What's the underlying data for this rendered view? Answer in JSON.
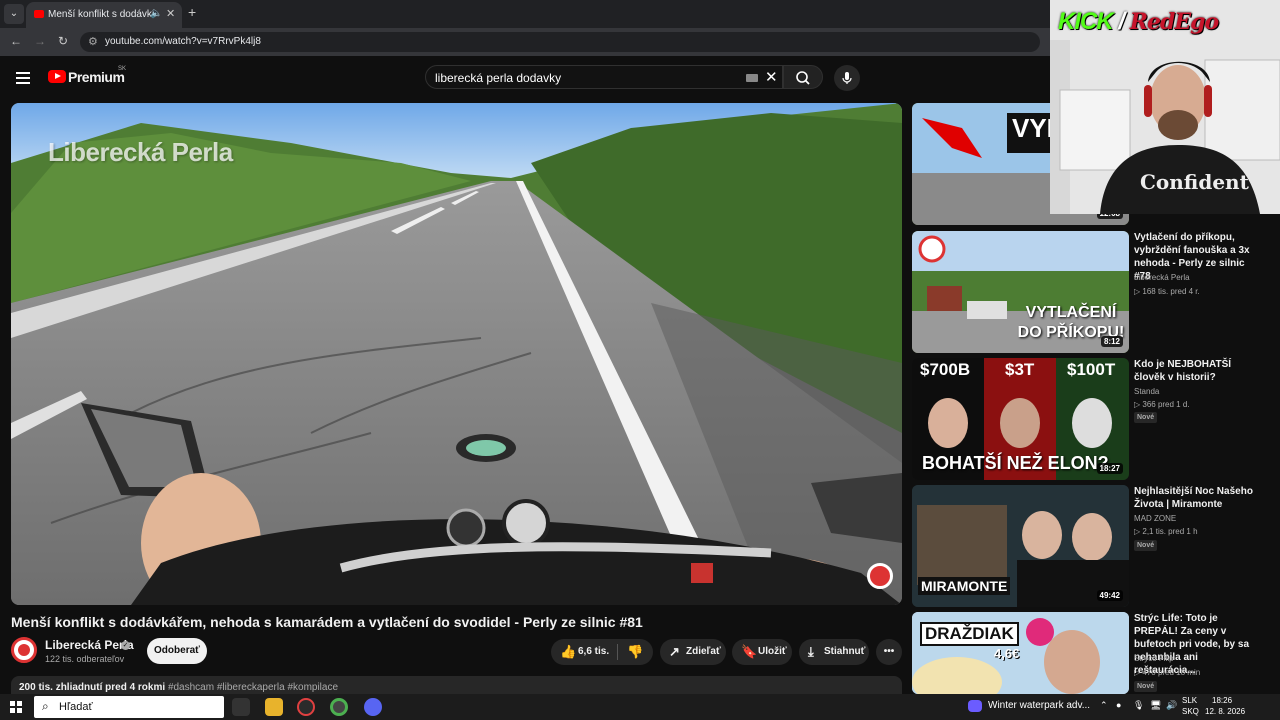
{
  "browser": {
    "tab_title": "Menší konflikt s dodávkář…",
    "url": "youtube.com/watch?v=v7RrvPk4lj8"
  },
  "masthead": {
    "logo_text": "Premium",
    "region": "SK",
    "search_query": "liberecká perla dodavky"
  },
  "video": {
    "watermark": "Liberecká Perla",
    "title": "Menší konflikt s dodávkářem, nehoda s kamarádem a vytlačení do svodidel - Perly ze silnic #81",
    "channel": "Liberecká Perla",
    "subscribers": "122 tis. odberateľov",
    "subscribe_label": "Odoberať",
    "likes": "6,6 tis.",
    "share_label": "Zdieľať",
    "save_label": "Uložiť",
    "download_label": "Stiahnuť",
    "views_date": "200 tis. zhliadnutí  pred 4 rokmi",
    "hashtags": "#dashcam #libereckaperla #kompilace"
  },
  "recommendations": [
    {
      "title": "",
      "channel": "",
      "meta": "",
      "duration": "12:08",
      "thumb_text": "VYH",
      "new": ""
    },
    {
      "title": "Vytlačení do příkopu, vybrždění fanouška a 3x nehoda - Perly ze silnic #78",
      "channel": "Liberecká Perla",
      "meta": "▷ 168 tis.   pred 4 r.",
      "duration": "8:12",
      "thumb_text": "VYTLAČENÍ DO PŘÍKOPU!",
      "new": ""
    },
    {
      "title": "Kdo je NEJBOHATŠÍ člověk v historii?",
      "channel": "Standa",
      "meta": "▷ 366   pred 1 d.",
      "duration": "18:27",
      "thumb_text": "BOHATŠÍ NEŽ ELON?",
      "thumb_top": [
        "$700B",
        "$3T",
        "$100T"
      ],
      "new": "Nové"
    },
    {
      "title": "Nejhlasitější Noc Našeho Života | Miramonte",
      "channel": "MAD ZONE",
      "meta": "▷ 2,1 tis.   pred 1 h",
      "duration": "49:42",
      "thumb_text": "MIRAMONTE",
      "new": "Nové"
    },
    {
      "title": "Strýc Life: Toto je PREPÁL! Za ceny v bufetoch pri vode, by sa nehanbila ani reštaurácia...",
      "channel": "Strýco Filip",
      "meta": "▷ 470   pred 18 min",
      "duration": "",
      "thumb_text": "DRAŽDIAK",
      "thumb_price": "4,6€",
      "new": "Nové"
    }
  ],
  "webcam": {
    "brand_kick": "KICK",
    "brand_sep": "/",
    "brand_name": "RedEgo",
    "shirt_text": "Confident"
  },
  "taskbar": {
    "search_placeholder": "Hľadať",
    "media_title": "Winter waterpark adv...",
    "lang_top": "SLK",
    "lang_bottom": "SKQ",
    "time": "18:26",
    "date": "12. 8. 2026"
  },
  "colors": {
    "youtube_red": "#ff0000",
    "kick_green": "#53fc18",
    "background": "#0f0f0f"
  }
}
